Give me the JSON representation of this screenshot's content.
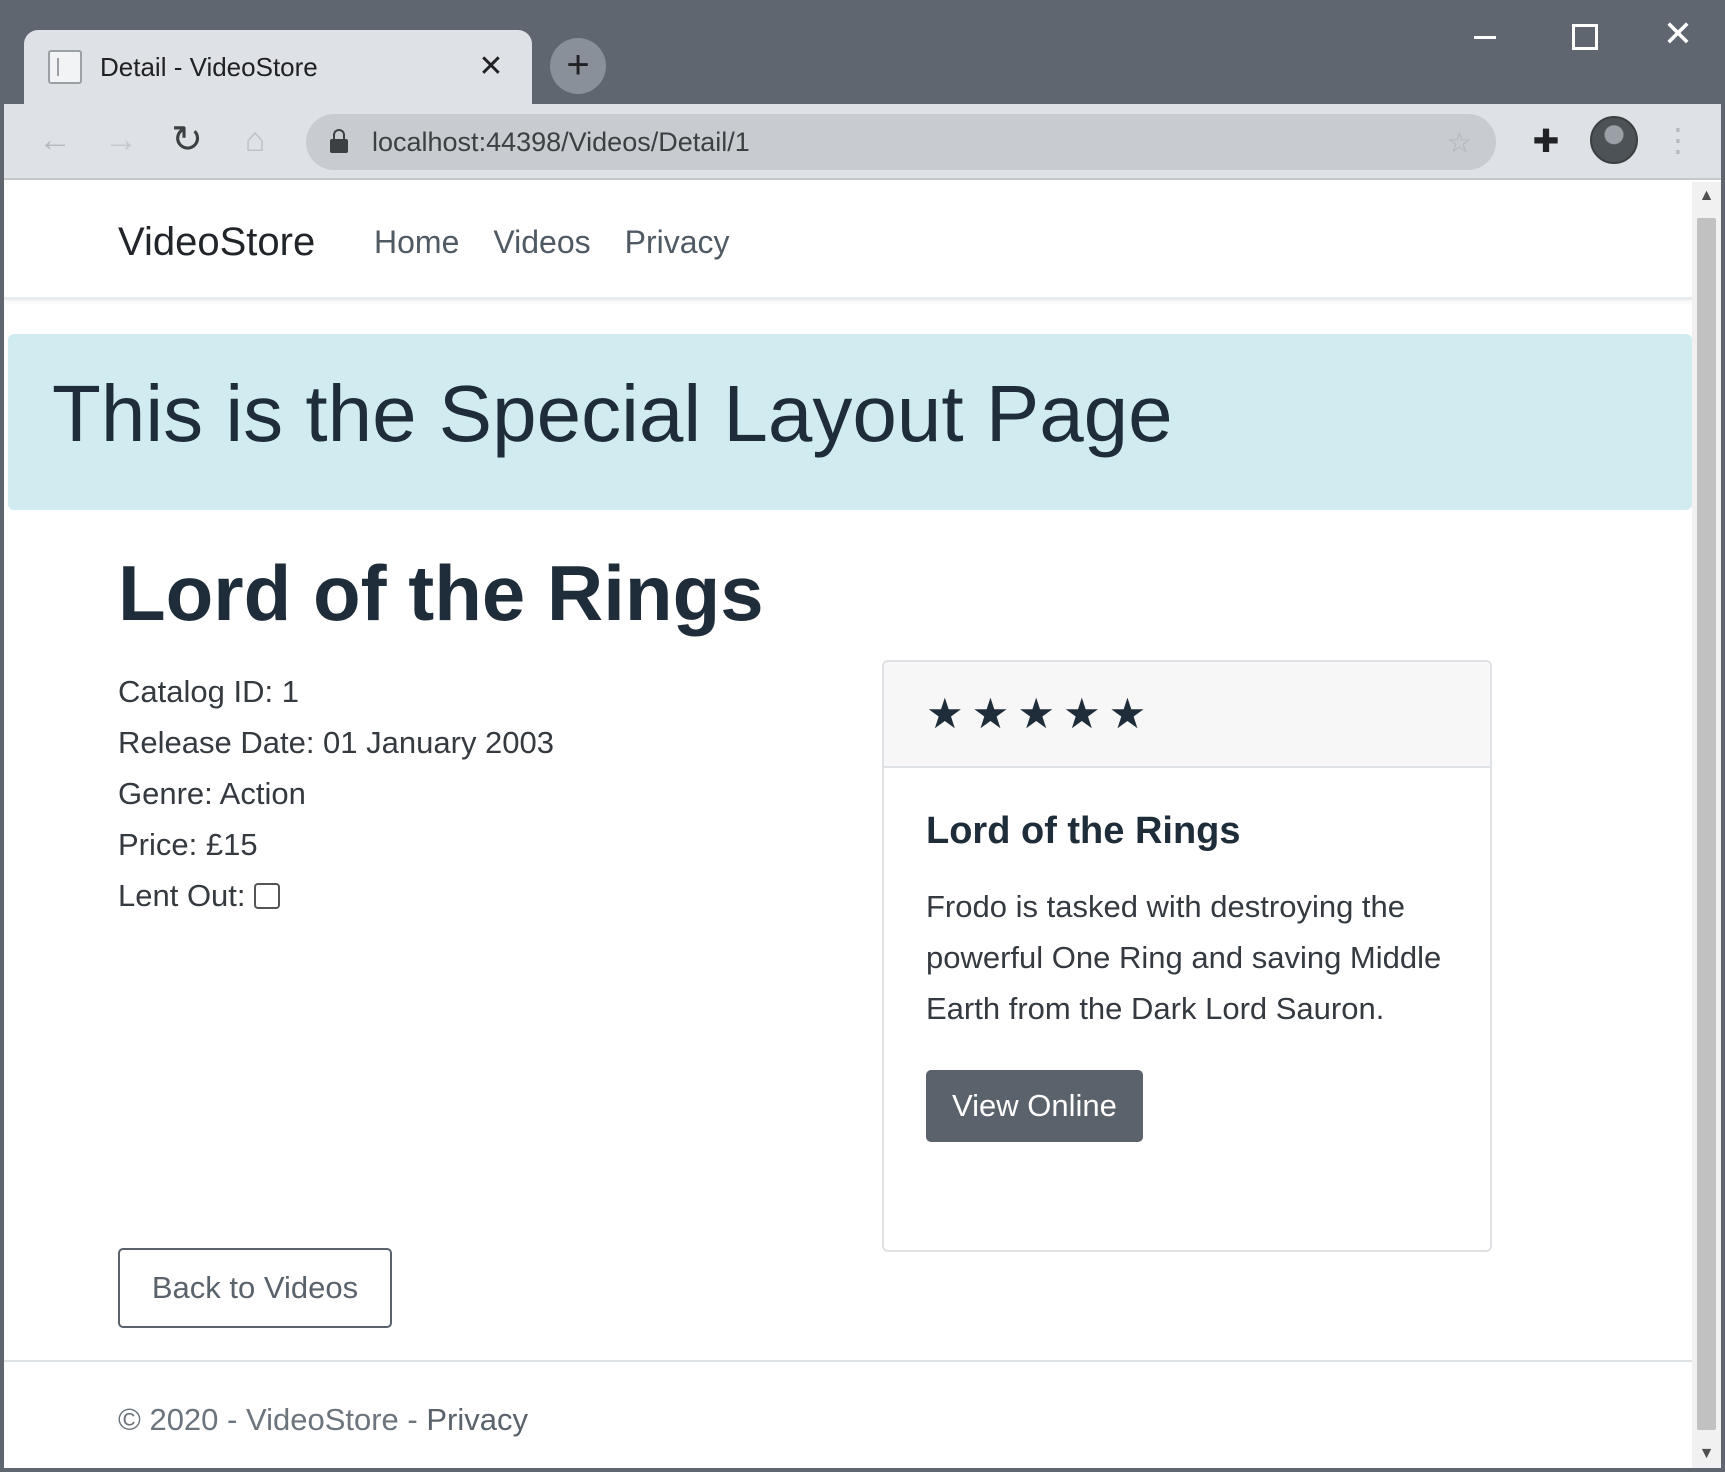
{
  "browser": {
    "tab_title": "Detail - VideoStore",
    "tab_close": "✕",
    "new_tab": "+",
    "url": "localhost:44398/Videos/Detail/1",
    "win_close": "✕"
  },
  "nav": {
    "brand": "VideoStore",
    "links": [
      "Home",
      "Videos",
      "Privacy"
    ]
  },
  "banner": {
    "title": "This is the Special Layout Page"
  },
  "video": {
    "title": "Lord of the Rings",
    "details": {
      "catalog_id": "Catalog ID: 1",
      "release_date": "Release Date: 01 January 2003",
      "genre": "Genre: Action",
      "price": "Price: £15",
      "lent_out_label": "Lent Out:"
    },
    "lent_out": false
  },
  "card": {
    "rating": 5,
    "rating_max": 5,
    "title": "Lord of the Rings",
    "text": "Frodo is tasked with destroying the powerful One Ring and saving Middle Earth from the Dark Lord Sauron.",
    "button": "View Online"
  },
  "back_button": "Back to Videos",
  "footer": {
    "text": "© 2020 - VideoStore - ",
    "link": "Privacy"
  },
  "colors": {
    "banner_bg": "#d1ecf1",
    "chrome_bg": "#5f6670",
    "button_bg": "#5a626b"
  }
}
